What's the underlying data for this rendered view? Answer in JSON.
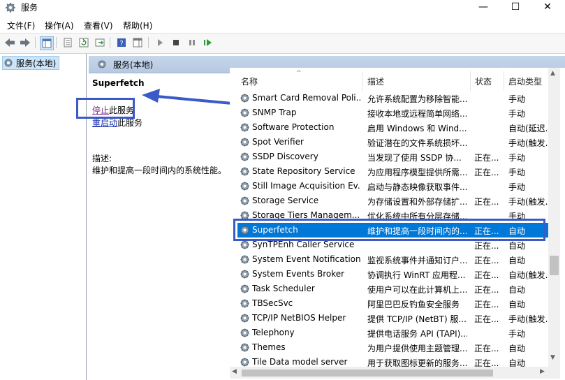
{
  "window": {
    "title": "服务"
  },
  "menu": [
    "文件(F)",
    "操作(A)",
    "查看(V)",
    "帮助(H)"
  ],
  "tree": {
    "item_label": "服务(本地)"
  },
  "panel": {
    "header": "服务(本地)"
  },
  "details": {
    "service_name": "Superfetch",
    "stop_link": "停止",
    "stop_suffix": "此服务",
    "restart_link": "重启动",
    "restart_suffix": "此服务",
    "desc_label": "描述:",
    "desc_text": "维护和提高一段时间内的系统性能。"
  },
  "table": {
    "columns": {
      "name": "名称",
      "desc": "描述",
      "status": "状态",
      "start": "启动类型"
    },
    "rows": [
      {
        "name": "Smart Card Removal Poli...",
        "desc": "允许系统配置为移除智能...",
        "status": "",
        "start": "手动"
      },
      {
        "name": "SNMP Trap",
        "desc": "接收本地或远程简单网络...",
        "status": "",
        "start": "手动"
      },
      {
        "name": "Software Protection",
        "desc": "启用 Windows 和 Wind...",
        "status": "",
        "start": "自动(延迟..."
      },
      {
        "name": "Spot Verifier",
        "desc": "验证潜在的文件系统损坏...",
        "status": "",
        "start": "手动(触发..."
      },
      {
        "name": "SSDP Discovery",
        "desc": "当发现了使用 SSDP 协...",
        "status": "正在...",
        "start": "手动"
      },
      {
        "name": "State Repository Service",
        "desc": "为应用程序模型提供所需...",
        "status": "正在...",
        "start": "手动"
      },
      {
        "name": "Still Image Acquisition Ev...",
        "desc": "启动与静态映像获取事件...",
        "status": "",
        "start": "手动"
      },
      {
        "name": "Storage Service",
        "desc": "为存储设置和外部存储扩...",
        "status": "正在...",
        "start": "手动(触发..."
      },
      {
        "name": "Storage Tiers Managem...",
        "desc": "优化系统中所有分层存储...",
        "status": "",
        "start": "手动"
      },
      {
        "name": "Superfetch",
        "desc": "维护和提高一段时间内的...",
        "status": "正在...",
        "start": "自动"
      },
      {
        "name": "SynTPEnh Caller Service",
        "desc": "",
        "status": "正在...",
        "start": "自动"
      },
      {
        "name": "System Event Notification...",
        "desc": "监视系统事件并通知订户...",
        "status": "正在...",
        "start": "自动"
      },
      {
        "name": "System Events Broker",
        "desc": "协调执行 WinRT 应用程...",
        "status": "正在...",
        "start": "自动(触发..."
      },
      {
        "name": "Task Scheduler",
        "desc": "使用户可以在此计算机上...",
        "status": "正在...",
        "start": "自动"
      },
      {
        "name": "TBSecSvc",
        "desc": "阿里巴巴反钓鱼安全服务",
        "status": "正在...",
        "start": "自动"
      },
      {
        "name": "TCP/IP NetBIOS Helper",
        "desc": "提供 TCP/IP (NetBT) 服...",
        "status": "正在...",
        "start": "手动(触发..."
      },
      {
        "name": "Telephony",
        "desc": "提供电话服务 API (TAPI)...",
        "status": "",
        "start": "手动"
      },
      {
        "name": "Themes",
        "desc": "为用户提供使用主题管理...",
        "status": "正在...",
        "start": "自动"
      },
      {
        "name": "Tile Data model server",
        "desc": "用于获取图标更新的服务...",
        "status": "正在...",
        "start": "自动"
      }
    ]
  },
  "colors": {
    "selected": "#0078d7",
    "highlight_box": "#3a5bc7",
    "arrow": "#3a5bc7"
  },
  "icons": [
    "gear-icon",
    "back-arrow-icon",
    "forward-arrow-icon",
    "play-icon",
    "stop-icon",
    "pause-icon",
    "restart-icon"
  ]
}
